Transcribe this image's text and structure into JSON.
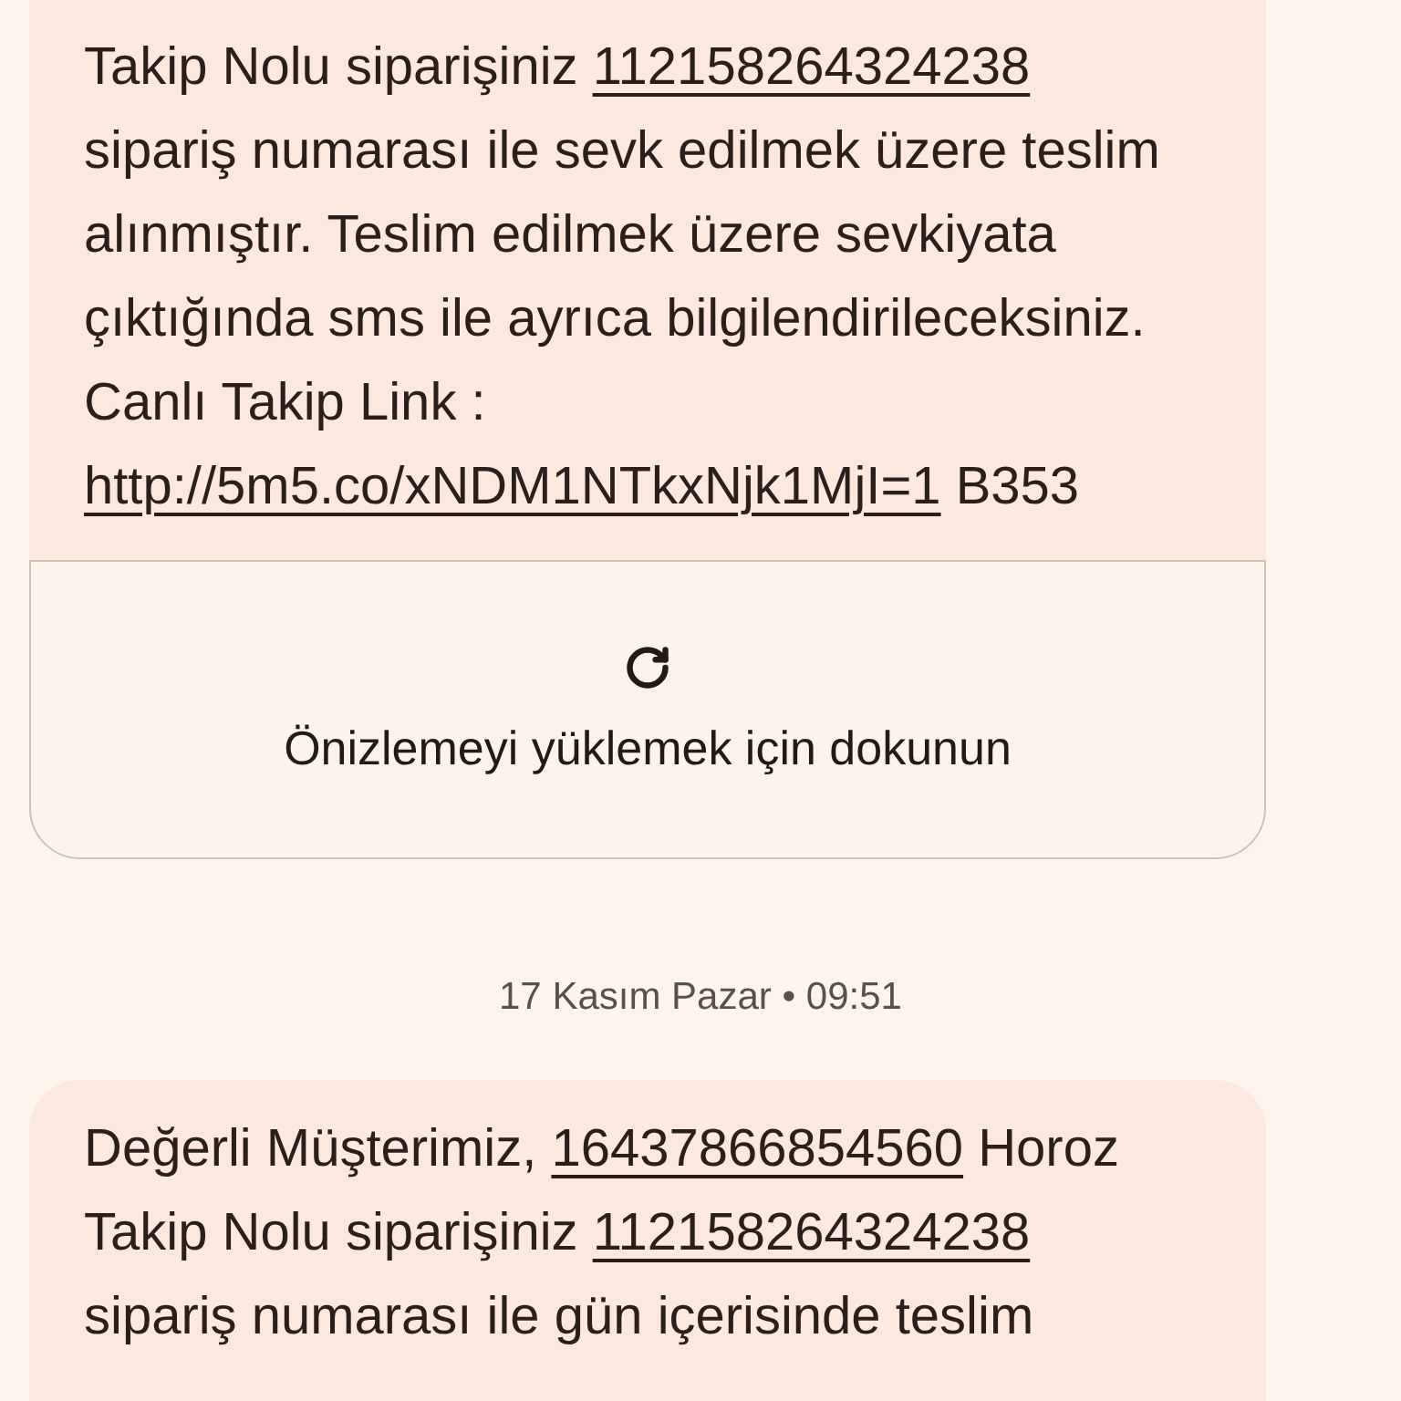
{
  "items": [
    {
      "kind": "message",
      "lines": [
        [
          {
            "kind": "text",
            "text": "Takip Nolu siparişiniz "
          },
          {
            "kind": "link",
            "text": "112158264324238"
          }
        ],
        [
          {
            "kind": "text",
            "text": "sipariş numarası ile sevk edilmek üzere teslim"
          }
        ],
        [
          {
            "kind": "text",
            "text": "alınmıştır. Teslim edilmek üzere sevkiyata"
          }
        ],
        [
          {
            "kind": "text",
            "text": "çıktığında sms ile ayrıca bilgilendirileceksiniz."
          }
        ],
        [
          {
            "kind": "text",
            "text": "Canlı Takip Link :"
          }
        ],
        [
          {
            "kind": "link",
            "text": "http://5m5.co/xNDM1NTkxNjk1MjI=1"
          },
          {
            "kind": "text",
            "text": " B353"
          }
        ]
      ],
      "preview": {
        "label": "Önizlemeyi yüklemek için dokunun"
      }
    },
    {
      "kind": "date",
      "text": "17 Kasım Pazar • 09:51"
    },
    {
      "kind": "message",
      "lines": [
        [
          {
            "kind": "text",
            "text": "Değerli Müşterimiz, "
          },
          {
            "kind": "link",
            "text": "16437866854560"
          },
          {
            "kind": "text",
            "text": " Horoz"
          }
        ],
        [
          {
            "kind": "text",
            "text": "Takip Nolu siparişiniz "
          },
          {
            "kind": "link",
            "text": "112158264324238"
          }
        ],
        [
          {
            "kind": "text",
            "text": "sipariş numarası ile gün içerisinde teslim"
          }
        ]
      ]
    }
  ]
}
